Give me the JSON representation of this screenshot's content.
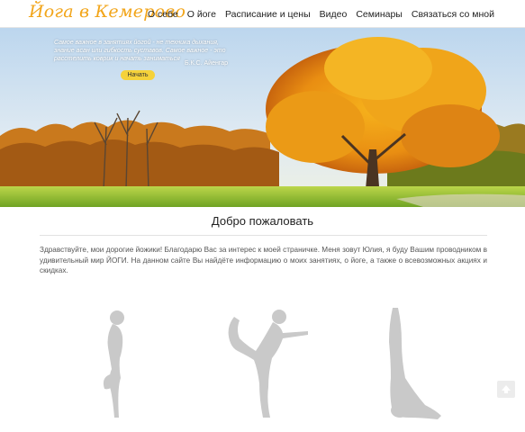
{
  "header": {
    "logo": "Йога в Кемерово",
    "nav": [
      {
        "label": "О себе"
      },
      {
        "label": "О йоге"
      },
      {
        "label": "Расписание и цены"
      },
      {
        "label": "Видео"
      },
      {
        "label": "Семинары"
      },
      {
        "label": "Связаться со мной"
      }
    ]
  },
  "hero": {
    "quote": "Самое важное в занятиях йогой - не техника дыхания, знание асан или гибкость суставов. Самое важное - это расстелить коврик и начать заниматься",
    "author": "Б.К.С. Айенгар",
    "button_label": "Начать"
  },
  "main": {
    "title": "Добро пожаловать",
    "intro": "Здравствуйте, мои дорогие йожики! Благодарю Вас за интерес к моей страничке. Меня зовут Юлия, я буду Вашим проводником в удивительный мир ЙОГИ. На данном сайте Вы найдёте информацию о моих занятиях, о йоге, а также о всевозможных акциях и скидках."
  },
  "colors": {
    "logo": "#f2a51a",
    "button": "#f5d23a",
    "figure": "#c9c9c9"
  },
  "icons": [
    "arrow-up-icon"
  ]
}
